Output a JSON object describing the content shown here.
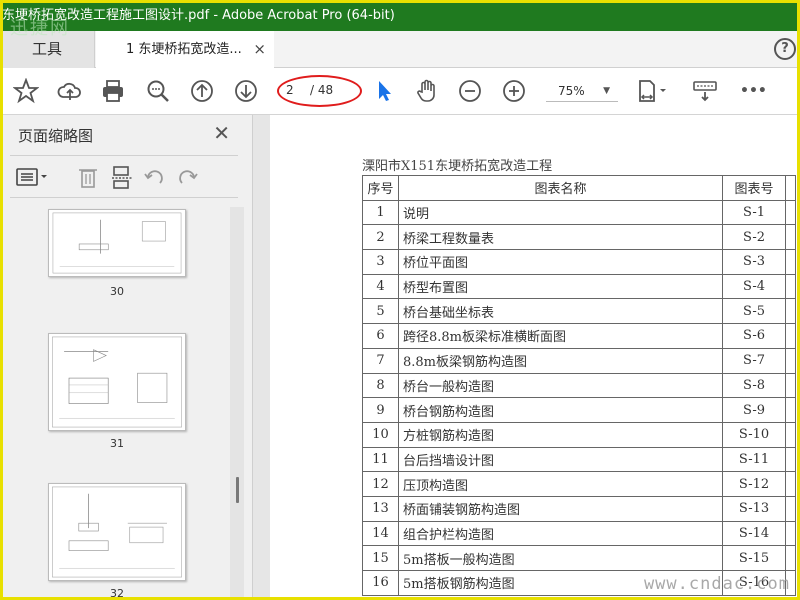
{
  "window": {
    "title": "东埂桥拓宽改造工程施工图设计.pdf - Adobe Acrobat Pro (64-bit)",
    "watermark": "迅捷网"
  },
  "tabs": {
    "tools_label": "工具",
    "doc_label": "1 东埂桥拓宽改造...",
    "close_glyph": "×",
    "help_glyph": "?"
  },
  "toolbar": {
    "icons": [
      "star-icon",
      "cloud-upload-icon",
      "print-icon",
      "search-zoom-icon",
      "page-up-icon",
      "page-down-icon",
      "select-cursor-icon",
      "hand-icon",
      "zoom-out-icon",
      "zoom-in-icon",
      "fit-page-icon",
      "keyboard-icon",
      "more-icon"
    ],
    "current_page": "2",
    "page_total": "/ 48",
    "zoom": "75%",
    "zoom_arrow": "▼",
    "more_glyph": "•••"
  },
  "sidepanel": {
    "title": "页面缩略图",
    "close_glyph": "✕",
    "collapse_glyph": "◀",
    "thumbnails": [
      {
        "label": "30"
      },
      {
        "label": "31"
      },
      {
        "label": "32"
      }
    ]
  },
  "document": {
    "heading": "溧阳市X151东埂桥拓宽改造工程",
    "columns": [
      "序号",
      "图表名称",
      "图表号"
    ],
    "rows": [
      [
        "1",
        "说明",
        "S-1"
      ],
      [
        "2",
        "桥梁工程数量表",
        "S-2"
      ],
      [
        "3",
        "桥位平面图",
        "S-3"
      ],
      [
        "4",
        "桥型布置图",
        "S-4"
      ],
      [
        "5",
        "桥台基础坐标表",
        "S-5"
      ],
      [
        "6",
        "跨径8.8m板梁标准横断面图",
        "S-6"
      ],
      [
        "7",
        "8.8m板梁钢筋构造图",
        "S-7"
      ],
      [
        "8",
        "桥台一般构造图",
        "S-8"
      ],
      [
        "9",
        "桥台钢筋构造图",
        "S-9"
      ],
      [
        "10",
        "方桩钢筋构造图",
        "S-10"
      ],
      [
        "11",
        "台后挡墙设计图",
        "S-11"
      ],
      [
        "12",
        "压顶构造图",
        "S-12"
      ],
      [
        "13",
        "桥面铺装钢筋构造图",
        "S-13"
      ],
      [
        "14",
        "组合护栏构造图",
        "S-14"
      ],
      [
        "15",
        "5m搭板一般构造图",
        "S-15"
      ],
      [
        "16",
        "5m搭板钢筋构造图",
        "S-16"
      ]
    ],
    "watermark": "www.cndac.com"
  },
  "colors": {
    "titlebar": "#1f7a1f",
    "frame": "#e8e000",
    "highlight_ellipse": "#e01c1c",
    "cursor_blue": "#1a73e8"
  }
}
